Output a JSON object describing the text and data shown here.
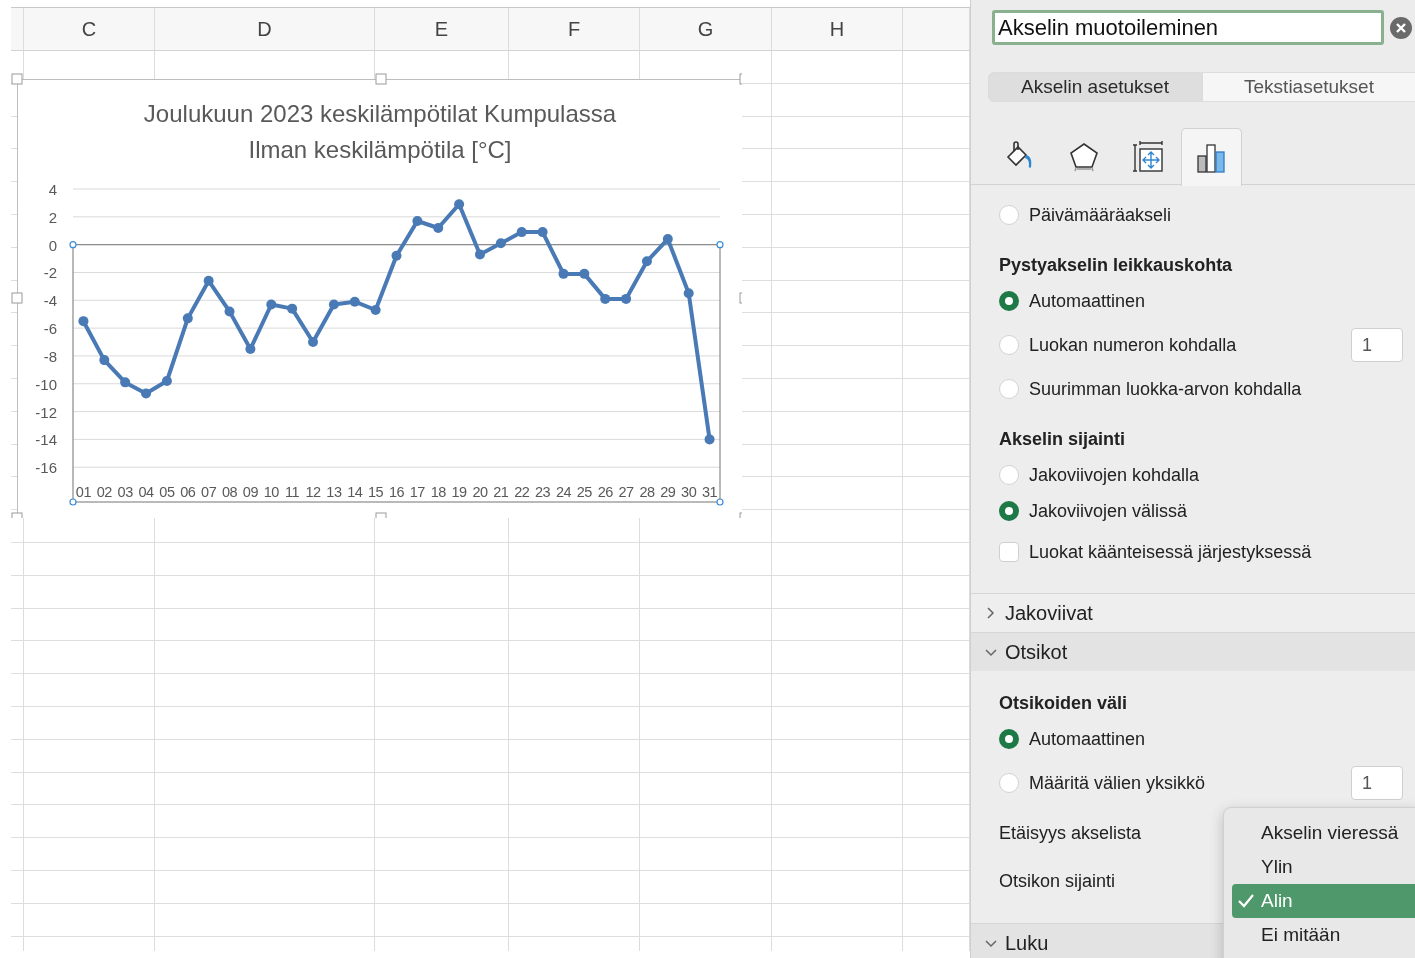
{
  "sheet": {
    "columns": [
      "C",
      "D",
      "E",
      "F",
      "G",
      "H"
    ]
  },
  "chart": {
    "subtitle": "Ilman keskilämpötila [°C]",
    "chart_data": {
      "type": "line",
      "title": "Joulukuun 2023 keskilämpötilat Kumpulassa",
      "categories": [
        "01",
        "02",
        "03",
        "04",
        "05",
        "06",
        "07",
        "08",
        "09",
        "10",
        "11",
        "12",
        "13",
        "14",
        "15",
        "16",
        "17",
        "18",
        "19",
        "20",
        "21",
        "22",
        "23",
        "24",
        "25",
        "26",
        "27",
        "28",
        "29",
        "30",
        "31"
      ],
      "values": [
        -5.5,
        -8.3,
        -9.9,
        -10.7,
        -9.8,
        -5.3,
        -2.6,
        -4.8,
        -7.5,
        -4.3,
        -4.6,
        -7.0,
        -4.3,
        -4.1,
        -4.7,
        -0.8,
        1.7,
        1.2,
        2.9,
        -0.7,
        0.1,
        0.9,
        0.9,
        -2.1,
        -2.1,
        -3.9,
        -3.9,
        -1.2,
        0.4,
        -3.5,
        -14.0
      ],
      "grid": true,
      "marker": true,
      "ylim": [
        -18.5,
        4
      ],
      "yticks": [
        4,
        2,
        0,
        -2,
        -4,
        -6,
        -8,
        -10,
        -12,
        -14,
        -16
      ]
    }
  },
  "pane": {
    "title": "Akselin muotoileminen",
    "tabs": [
      {
        "label": "Akselin asetukset",
        "selected": true
      },
      {
        "label": "Tekstiasetukset",
        "selected": false
      }
    ],
    "icon_tabs": [
      {
        "kind": "fill",
        "selected": false
      },
      {
        "kind": "effects",
        "selected": false
      },
      {
        "kind": "size",
        "selected": false
      },
      {
        "kind": "options",
        "selected": true
      }
    ],
    "items": [
      {
        "kind": "radio",
        "label": "Päivämääräakseli",
        "selected": false
      },
      {
        "kind": "heading",
        "label": "Pystyakselin leikkauskohta"
      },
      {
        "kind": "radio",
        "label": "Automaattinen",
        "selected": true
      },
      {
        "kind": "radio",
        "label": "Luokan numeron kohdalla",
        "selected": false,
        "value": "1"
      },
      {
        "kind": "radio",
        "label": "Suurimman luokka-arvon kohdalla",
        "selected": false
      },
      {
        "kind": "heading",
        "label": "Akselin sijainti"
      },
      {
        "kind": "radio",
        "label": "Jakoviivojen kohdalla",
        "selected": false
      },
      {
        "kind": "radio",
        "label": "Jakoviivojen välissä",
        "selected": true
      },
      {
        "kind": "checkbox",
        "label": "Luokat käänteisessä järjestyksessä",
        "checked": false
      },
      {
        "kind": "section",
        "label": "Jakoviivat",
        "expanded": false
      },
      {
        "kind": "section",
        "label": "Otsikot",
        "expanded": true
      },
      {
        "kind": "heading",
        "label": "Otsikoiden väli"
      },
      {
        "kind": "radio",
        "label": "Automaattinen",
        "selected": true
      },
      {
        "kind": "radio",
        "label": "Määritä välien yksikkö",
        "selected": false,
        "value": "1"
      },
      {
        "kind": "label",
        "label": "Etäisyys akselista"
      },
      {
        "kind": "label",
        "label": "Otsikon sijainti"
      },
      {
        "kind": "section",
        "label": "Luku",
        "expanded": true
      }
    ],
    "menu": {
      "items": [
        {
          "label": "Akselin vieressä",
          "selected": false
        },
        {
          "label": "Ylin",
          "selected": false
        },
        {
          "label": "Alin",
          "selected": true
        },
        {
          "label": "Ei mitään",
          "selected": false
        }
      ]
    }
  }
}
